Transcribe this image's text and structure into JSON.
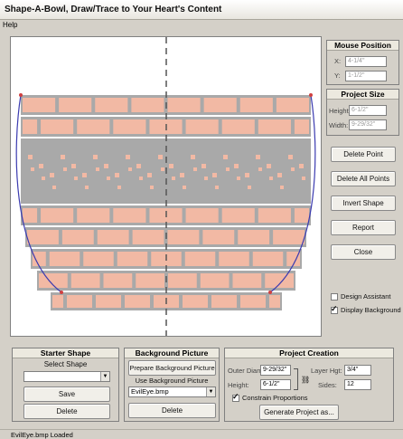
{
  "window": {
    "title": "Shape-A-Bowl, Draw/Trace to Your Heart's Content"
  },
  "menu": {
    "help": "Help"
  },
  "mouse_position": {
    "header": "Mouse Position",
    "x_label": "X:",
    "x_value": "4-1/4\"",
    "y_label": "Y:",
    "y_value": "1-1/2\""
  },
  "project_size": {
    "header": "Project Size",
    "height_label": "Height:",
    "height_value": "6-1/2\"",
    "width_label": "Width:",
    "width_value": "9-29/32\""
  },
  "actions": {
    "delete_point": "Delete Point",
    "delete_all_points": "Delete All Points",
    "invert_shape": "Invert Shape",
    "report": "Report",
    "close": "Close"
  },
  "options": {
    "design_assistant": "Design Assistant",
    "design_assistant_checked": false,
    "display_background": "Display Background",
    "display_background_checked": true
  },
  "starter_shape": {
    "header": "Starter Shape",
    "select_label": "Select Shape",
    "select_value": "",
    "save": "Save",
    "delete": "Delete"
  },
  "background_picture": {
    "header": "Background Picture",
    "prepare": "Prepare Background Picture",
    "use_label": "Use Background Picture",
    "select_value": "EvilEye.bmp",
    "delete": "Delete"
  },
  "project_creation": {
    "header": "Project Creation",
    "outer_diam_label": "Outer Diam:",
    "outer_diam_value": "9-29/32\"",
    "height_label": "Height:",
    "height_value": "6-1/2\"",
    "layer_hgt_label": "Layer Hgt:",
    "layer_hgt_value": "3/4\"",
    "sides_label": "Sides:",
    "sides_value": "12",
    "constrain_label": "Constrain Proportions",
    "constrain_checked": true,
    "generate": "Generate Project as..."
  },
  "status": {
    "text": "EvilEye.bmp Loaded"
  },
  "colors": {
    "brick": "#f2b9a4",
    "pattern": "#a9a9a9",
    "mortar": "#a9a9a9",
    "curve": "#3b3bb0",
    "point": "#d04040"
  }
}
